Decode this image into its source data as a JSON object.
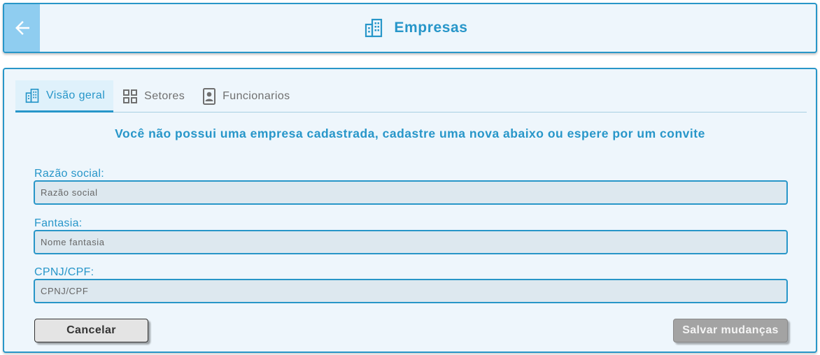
{
  "header": {
    "title": "Empresas",
    "back_icon": "arrow-left-icon",
    "title_icon": "building-icon"
  },
  "tabs": [
    {
      "label": "Visão geral",
      "icon": "building-icon",
      "active": true
    },
    {
      "label": "Setores",
      "icon": "grid-icon",
      "active": false
    },
    {
      "label": "Funcionarios",
      "icon": "badge-icon",
      "active": false
    }
  ],
  "notice": "Você não possui uma empresa cadastrada, cadastre uma nova abaixo ou espere por um convite",
  "form": {
    "razao_social": {
      "label": "Razão social:",
      "placeholder": "Razão social",
      "value": ""
    },
    "fantasia": {
      "label": "Fantasia:",
      "placeholder": "Nome fantasia",
      "value": ""
    },
    "cpnj": {
      "label": "CPNJ/CPF:",
      "placeholder": "CPNJ/CPF",
      "value": ""
    }
  },
  "buttons": {
    "cancel": "Cancelar",
    "save": "Salvar mudanças"
  },
  "colors": {
    "accent": "#2796c9",
    "back_button": "#8fcdf0",
    "background": "#eef6fc",
    "input_background": "#dde8ef",
    "save_disabled": "#a3a3a3"
  }
}
